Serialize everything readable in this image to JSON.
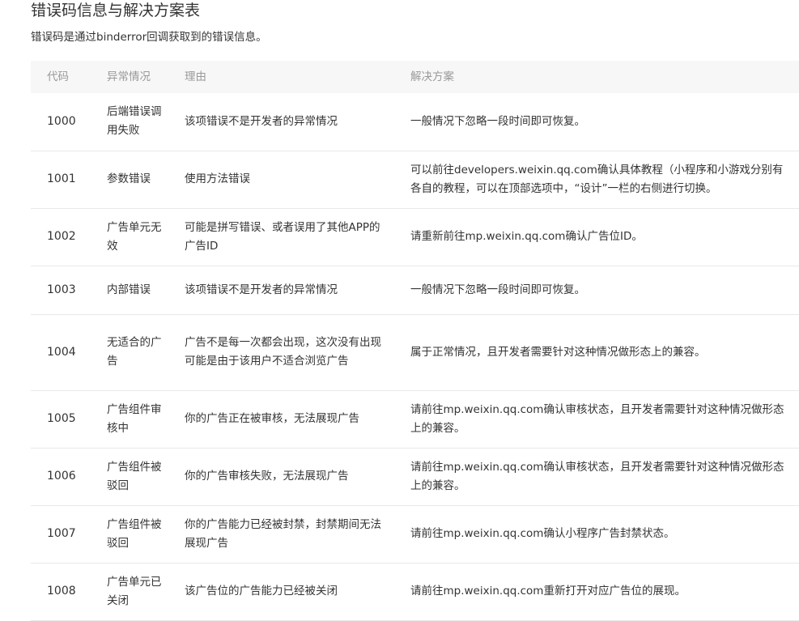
{
  "title": "错误码信息与解决方案表",
  "description": "错误码是通过binderror回调获取到的错误信息。",
  "table": {
    "headers": [
      "代码",
      "异常情况",
      "理由",
      "解决方案"
    ],
    "rows": [
      {
        "code": "1000",
        "situation": "后端错误调用失败",
        "reason": "该项错误不是开发者的异常情况",
        "solution": "一般情况下忽略一段时间即可恢复。"
      },
      {
        "code": "1001",
        "situation": "参数错误",
        "reason": "使用方法错误",
        "solution": "可以前往developers.weixin.qq.com确认具体教程（小程序和小游戏分别有各自的教程，可以在顶部选项中，“设计”一栏的右侧进行切换。"
      },
      {
        "code": "1002",
        "situation": "广告单元无效",
        "reason": "可能是拼写错误、或者误用了其他APP的广告ID",
        "solution": "请重新前往mp.weixin.qq.com确认广告位ID。"
      },
      {
        "code": "1003",
        "situation": "内部错误",
        "reason": "该项错误不是开发者的异常情况",
        "solution": "一般情况下忽略一段时间即可恢复。"
      },
      {
        "code": "1004",
        "situation": "无适合的广告",
        "reason": "广告不是每一次都会出现，这次没有出现可能是由于该用户不适合浏览广告",
        "solution": "属于正常情况，且开发者需要针对这种情况做形态上的兼容。"
      },
      {
        "code": "1005",
        "situation": "广告组件审核中",
        "reason": "你的广告正在被审核，无法展现广告",
        "solution": "请前往mp.weixin.qq.com确认审核状态，且开发者需要针对这种情况做形态上的兼容。"
      },
      {
        "code": "1006",
        "situation": "广告组件被驳回",
        "reason": "你的广告审核失败，无法展现广告",
        "solution": "请前往mp.weixin.qq.com确认审核状态，且开发者需要针对这种情况做形态上的兼容。"
      },
      {
        "code": "1007",
        "situation": "广告组件被驳回",
        "reason": "你的广告能力已经被封禁，封禁期间无法展现广告",
        "solution": "请前往mp.weixin.qq.com确认小程序广告封禁状态。"
      },
      {
        "code": "1008",
        "situation": "广告单元已关闭",
        "reason": "该广告位的广告能力已经被关闭",
        "solution": "请前往mp.weixin.qq.com重新打开对应广告位的展现。"
      }
    ]
  }
}
